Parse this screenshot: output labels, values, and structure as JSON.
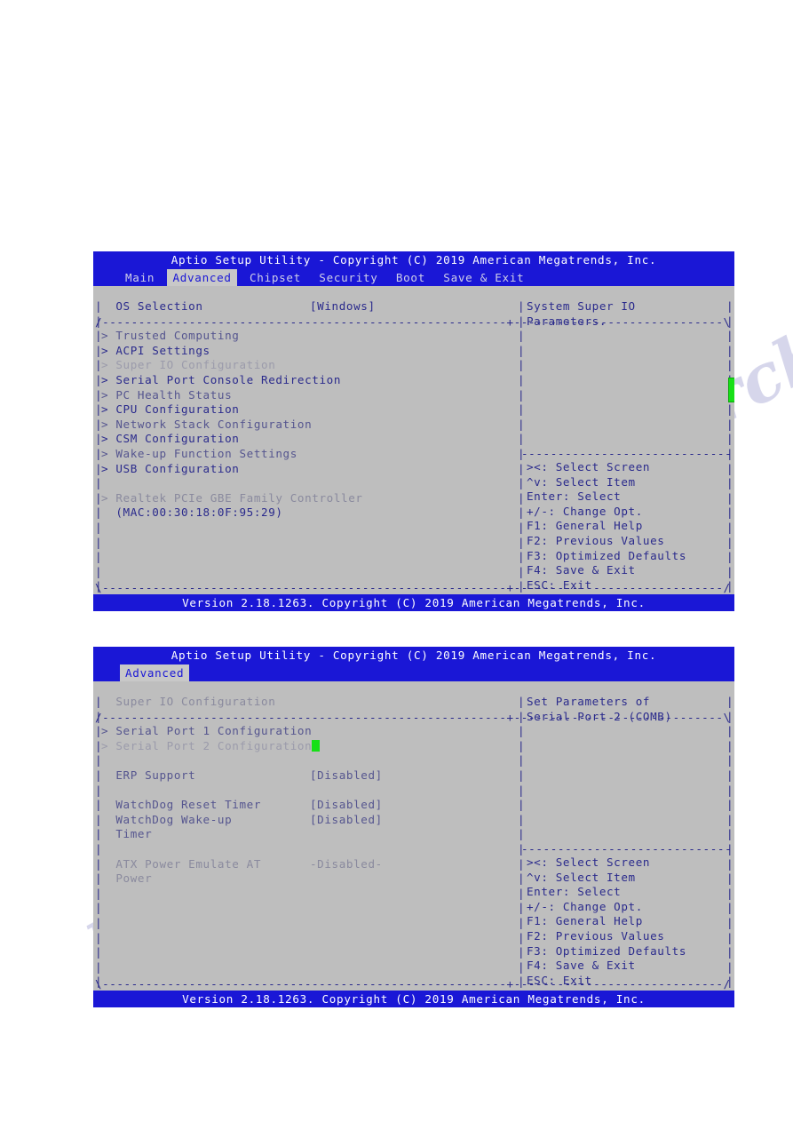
{
  "screens": [
    {
      "title": "Aptio Setup Utility - Copyright (C) 2019 American Megatrends, Inc.",
      "tabs": [
        {
          "label": "Main",
          "active": false
        },
        {
          "label": "Advanced",
          "active": true
        },
        {
          "label": "Chipset",
          "active": false
        },
        {
          "label": "Security",
          "active": false
        },
        {
          "label": "Boot",
          "active": false
        },
        {
          "label": "Save & Exit",
          "active": false
        }
      ],
      "items": [
        {
          "label": "OS Selection",
          "value": "[Windows]",
          "arrow": false,
          "tone": "c-dark"
        },
        {
          "label": "",
          "value": "",
          "arrow": false,
          "tone": "c-dark"
        },
        {
          "label": "Trusted Computing",
          "value": "",
          "arrow": true,
          "tone": "c-mid"
        },
        {
          "label": "ACPI Settings",
          "value": "",
          "arrow": true,
          "tone": "c-dark"
        },
        {
          "label": "Super IO Configuration",
          "value": "",
          "arrow": true,
          "tone": "c-light"
        },
        {
          "label": "Serial Port Console Redirection",
          "value": "",
          "arrow": true,
          "tone": "c-dark"
        },
        {
          "label": "PC Health Status",
          "value": "",
          "arrow": true,
          "tone": "c-mid"
        },
        {
          "label": "CPU Configuration",
          "value": "",
          "arrow": true,
          "tone": "c-dark"
        },
        {
          "label": "Network Stack Configuration",
          "value": "",
          "arrow": true,
          "tone": "c-mid"
        },
        {
          "label": "CSM Configuration",
          "value": "",
          "arrow": true,
          "tone": "c-dark"
        },
        {
          "label": "Wake-up Function Settings",
          "value": "",
          "arrow": true,
          "tone": "c-mid"
        },
        {
          "label": "USB Configuration",
          "value": "",
          "arrow": true,
          "tone": "c-dark"
        },
        {
          "label": "",
          "value": "",
          "arrow": false,
          "tone": "c-dark"
        },
        {
          "label": "Realtek PCIe GBE Family Controller",
          "value": "",
          "arrow": true,
          "tone": "c-gray"
        },
        {
          "label": "(MAC:00:30:18:0F:95:29)",
          "value": "",
          "arrow": false,
          "tone": "c-dark"
        }
      ],
      "help_text": [
        "System Super IO",
        "Parameters."
      ],
      "keys": [
        "><: Select Screen",
        "^v: Select Item",
        "Enter: Select",
        "+/-: Change Opt.",
        "F1: General Help",
        "F2: Previous Values",
        "F3: Optimized Defaults",
        "F4: Save & Exit",
        "ESC: Exit"
      ],
      "footer": "Version 2.18.1263. Copyright (C) 2019 American Megatrends, Inc.",
      "scrollbar_visible": true
    },
    {
      "title": "Aptio Setup Utility - Copyright (C) 2019 American Megatrends, Inc.",
      "tabs": [
        {
          "label": "Advanced",
          "active": true
        }
      ],
      "items": [
        {
          "label": "Super IO Configuration",
          "value": "",
          "arrow": false,
          "tone": "c-gray"
        },
        {
          "label": "",
          "value": "",
          "arrow": false,
          "tone": "c-dark"
        },
        {
          "label": "Serial Port 1 Configuration",
          "value": "",
          "arrow": true,
          "tone": "c-mid"
        },
        {
          "label": "Serial Port 2 Configuration",
          "value": "",
          "arrow": true,
          "tone": "c-light",
          "cursor": true
        },
        {
          "label": "",
          "value": "",
          "arrow": false,
          "tone": "c-dark"
        },
        {
          "label": "ERP Support",
          "value": "[Disabled]",
          "arrow": false,
          "tone": "c-mid"
        },
        {
          "label": "",
          "value": "",
          "arrow": false,
          "tone": "c-dark"
        },
        {
          "label": "WatchDog Reset Timer",
          "value": "[Disabled]",
          "arrow": false,
          "tone": "c-mid"
        },
        {
          "label": "WatchDog Wake-up",
          "value": "[Disabled]",
          "arrow": false,
          "tone": "c-mid"
        },
        {
          "label": "Timer",
          "value": "",
          "arrow": false,
          "tone": "c-mid"
        },
        {
          "label": "",
          "value": "",
          "arrow": false,
          "tone": "c-dark"
        },
        {
          "label": "ATX Power Emulate AT",
          "value": "-Disabled-",
          "arrow": false,
          "tone": "c-gray"
        },
        {
          "label": "Power",
          "value": "",
          "arrow": false,
          "tone": "c-gray"
        }
      ],
      "help_text": [
        "Set Parameters of",
        "Serial Port 2 (COMB)"
      ],
      "keys": [
        "><: Select Screen",
        "^v: Select Item",
        "Enter: Select",
        "+/-: Change Opt.",
        "F1: General Help",
        "F2: Previous Values",
        "F3: Optimized Defaults",
        "F4: Save & Exit",
        "ESC: Exit"
      ],
      "footer": "Version 2.18.1263. Copyright (C) 2019 American Megatrends, Inc.",
      "scrollbar_visible": false
    }
  ],
  "watermarks": [
    "manualsarchive.com",
    "manualsarchive"
  ],
  "colors": {
    "header_blue": "#1a17d6",
    "body_gray": "#bebebe",
    "text_blue": "#2a2a8c",
    "cursor_green": "#17e017",
    "tab_active_bg": "#c8c8c8"
  }
}
